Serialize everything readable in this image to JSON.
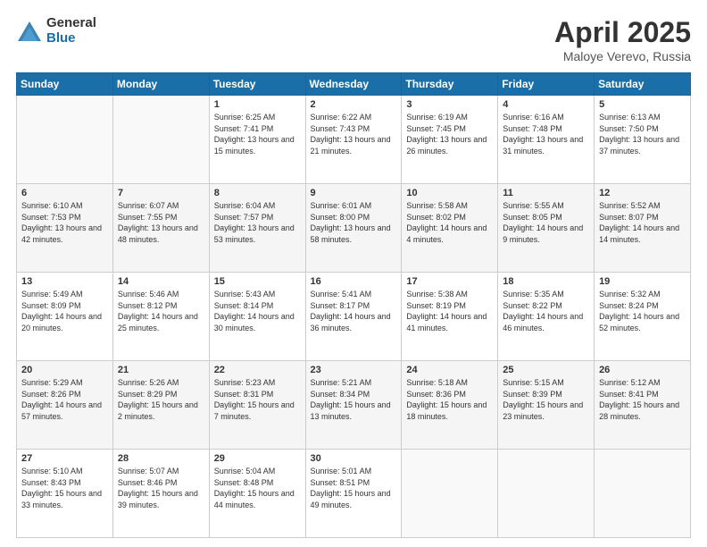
{
  "header": {
    "logo_general": "General",
    "logo_blue": "Blue",
    "title": "April 2025",
    "location": "Maloye Verevo, Russia"
  },
  "days_of_week": [
    "Sunday",
    "Monday",
    "Tuesday",
    "Wednesday",
    "Thursday",
    "Friday",
    "Saturday"
  ],
  "weeks": [
    [
      {
        "day": "",
        "sunrise": "",
        "sunset": "",
        "daylight": ""
      },
      {
        "day": "",
        "sunrise": "",
        "sunset": "",
        "daylight": ""
      },
      {
        "day": "1",
        "sunrise": "Sunrise: 6:25 AM",
        "sunset": "Sunset: 7:41 PM",
        "daylight": "Daylight: 13 hours and 15 minutes."
      },
      {
        "day": "2",
        "sunrise": "Sunrise: 6:22 AM",
        "sunset": "Sunset: 7:43 PM",
        "daylight": "Daylight: 13 hours and 21 minutes."
      },
      {
        "day": "3",
        "sunrise": "Sunrise: 6:19 AM",
        "sunset": "Sunset: 7:45 PM",
        "daylight": "Daylight: 13 hours and 26 minutes."
      },
      {
        "day": "4",
        "sunrise": "Sunrise: 6:16 AM",
        "sunset": "Sunset: 7:48 PM",
        "daylight": "Daylight: 13 hours and 31 minutes."
      },
      {
        "day": "5",
        "sunrise": "Sunrise: 6:13 AM",
        "sunset": "Sunset: 7:50 PM",
        "daylight": "Daylight: 13 hours and 37 minutes."
      }
    ],
    [
      {
        "day": "6",
        "sunrise": "Sunrise: 6:10 AM",
        "sunset": "Sunset: 7:53 PM",
        "daylight": "Daylight: 13 hours and 42 minutes."
      },
      {
        "day": "7",
        "sunrise": "Sunrise: 6:07 AM",
        "sunset": "Sunset: 7:55 PM",
        "daylight": "Daylight: 13 hours and 48 minutes."
      },
      {
        "day": "8",
        "sunrise": "Sunrise: 6:04 AM",
        "sunset": "Sunset: 7:57 PM",
        "daylight": "Daylight: 13 hours and 53 minutes."
      },
      {
        "day": "9",
        "sunrise": "Sunrise: 6:01 AM",
        "sunset": "Sunset: 8:00 PM",
        "daylight": "Daylight: 13 hours and 58 minutes."
      },
      {
        "day": "10",
        "sunrise": "Sunrise: 5:58 AM",
        "sunset": "Sunset: 8:02 PM",
        "daylight": "Daylight: 14 hours and 4 minutes."
      },
      {
        "day": "11",
        "sunrise": "Sunrise: 5:55 AM",
        "sunset": "Sunset: 8:05 PM",
        "daylight": "Daylight: 14 hours and 9 minutes."
      },
      {
        "day": "12",
        "sunrise": "Sunrise: 5:52 AM",
        "sunset": "Sunset: 8:07 PM",
        "daylight": "Daylight: 14 hours and 14 minutes."
      }
    ],
    [
      {
        "day": "13",
        "sunrise": "Sunrise: 5:49 AM",
        "sunset": "Sunset: 8:09 PM",
        "daylight": "Daylight: 14 hours and 20 minutes."
      },
      {
        "day": "14",
        "sunrise": "Sunrise: 5:46 AM",
        "sunset": "Sunset: 8:12 PM",
        "daylight": "Daylight: 14 hours and 25 minutes."
      },
      {
        "day": "15",
        "sunrise": "Sunrise: 5:43 AM",
        "sunset": "Sunset: 8:14 PM",
        "daylight": "Daylight: 14 hours and 30 minutes."
      },
      {
        "day": "16",
        "sunrise": "Sunrise: 5:41 AM",
        "sunset": "Sunset: 8:17 PM",
        "daylight": "Daylight: 14 hours and 36 minutes."
      },
      {
        "day": "17",
        "sunrise": "Sunrise: 5:38 AM",
        "sunset": "Sunset: 8:19 PM",
        "daylight": "Daylight: 14 hours and 41 minutes."
      },
      {
        "day": "18",
        "sunrise": "Sunrise: 5:35 AM",
        "sunset": "Sunset: 8:22 PM",
        "daylight": "Daylight: 14 hours and 46 minutes."
      },
      {
        "day": "19",
        "sunrise": "Sunrise: 5:32 AM",
        "sunset": "Sunset: 8:24 PM",
        "daylight": "Daylight: 14 hours and 52 minutes."
      }
    ],
    [
      {
        "day": "20",
        "sunrise": "Sunrise: 5:29 AM",
        "sunset": "Sunset: 8:26 PM",
        "daylight": "Daylight: 14 hours and 57 minutes."
      },
      {
        "day": "21",
        "sunrise": "Sunrise: 5:26 AM",
        "sunset": "Sunset: 8:29 PM",
        "daylight": "Daylight: 15 hours and 2 minutes."
      },
      {
        "day": "22",
        "sunrise": "Sunrise: 5:23 AM",
        "sunset": "Sunset: 8:31 PM",
        "daylight": "Daylight: 15 hours and 7 minutes."
      },
      {
        "day": "23",
        "sunrise": "Sunrise: 5:21 AM",
        "sunset": "Sunset: 8:34 PM",
        "daylight": "Daylight: 15 hours and 13 minutes."
      },
      {
        "day": "24",
        "sunrise": "Sunrise: 5:18 AM",
        "sunset": "Sunset: 8:36 PM",
        "daylight": "Daylight: 15 hours and 18 minutes."
      },
      {
        "day": "25",
        "sunrise": "Sunrise: 5:15 AM",
        "sunset": "Sunset: 8:39 PM",
        "daylight": "Daylight: 15 hours and 23 minutes."
      },
      {
        "day": "26",
        "sunrise": "Sunrise: 5:12 AM",
        "sunset": "Sunset: 8:41 PM",
        "daylight": "Daylight: 15 hours and 28 minutes."
      }
    ],
    [
      {
        "day": "27",
        "sunrise": "Sunrise: 5:10 AM",
        "sunset": "Sunset: 8:43 PM",
        "daylight": "Daylight: 15 hours and 33 minutes."
      },
      {
        "day": "28",
        "sunrise": "Sunrise: 5:07 AM",
        "sunset": "Sunset: 8:46 PM",
        "daylight": "Daylight: 15 hours and 39 minutes."
      },
      {
        "day": "29",
        "sunrise": "Sunrise: 5:04 AM",
        "sunset": "Sunset: 8:48 PM",
        "daylight": "Daylight: 15 hours and 44 minutes."
      },
      {
        "day": "30",
        "sunrise": "Sunrise: 5:01 AM",
        "sunset": "Sunset: 8:51 PM",
        "daylight": "Daylight: 15 hours and 49 minutes."
      },
      {
        "day": "",
        "sunrise": "",
        "sunset": "",
        "daylight": ""
      },
      {
        "day": "",
        "sunrise": "",
        "sunset": "",
        "daylight": ""
      },
      {
        "day": "",
        "sunrise": "",
        "sunset": "",
        "daylight": ""
      }
    ]
  ]
}
